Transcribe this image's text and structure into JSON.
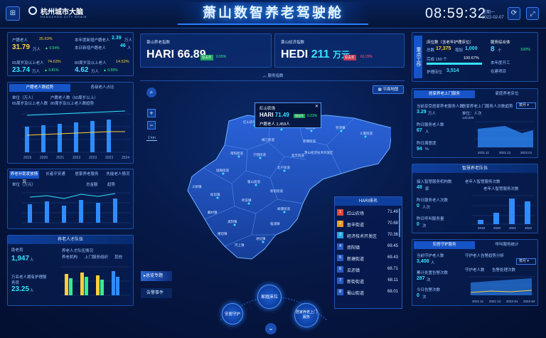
{
  "header": {
    "logo_text": "杭州城市大脑",
    "logo_sub": "HANGZHOU CITY BRAIN",
    "title": "萧山数智养老驾驶舱",
    "time": "08:59:32",
    "weekday": "星期一",
    "date": "2022-02-07"
  },
  "left1": {
    "items": [
      {
        "label": "户籍老人",
        "pct": "25.63%",
        "val": "31.79",
        "unit": "万人",
        "trend": "▲ 0.54%"
      },
      {
        "label": "本年度新增户籍老人",
        "val": "2.39",
        "unit": "万人"
      },
      {
        "label": "本日新增户籍老人",
        "val": "46",
        "unit": "人"
      },
      {
        "label": "65周岁及以上老人",
        "pct": "74.63%",
        "val": "23.74",
        "unit": "万人",
        "trend": "▲ 0.81%"
      },
      {
        "label": "80周岁及以上老人",
        "pct": "14.52%",
        "val": "4.62",
        "unit": "万人",
        "trend": "▲ 0.99%"
      }
    ]
  },
  "left2": {
    "tabs": [
      "户籍老人数趋势",
      "各级老人占比"
    ],
    "unit": "单位（万人）",
    "legend": [
      "户籍老人数（60周岁以上）",
      "65周岁及以上老人数",
      "80周岁及以上老人数趋势"
    ]
  },
  "left3": {
    "tabs": [
      "养老补助发放情况",
      "长者平安通",
      "居家养老服务",
      "失能老人情况"
    ],
    "unit": "单位（万元）",
    "legend": [
      "总金额",
      "趋势"
    ]
  },
  "left4": {
    "title": "养老人才队伍",
    "sub": "养老人才队伍情况",
    "items": [
      {
        "label": "助老员",
        "val": "1,947",
        "unit": "人"
      },
      {
        "label": "万名老人拥有护理服务员",
        "val": "23.25",
        "unit": "人"
      }
    ],
    "legend": [
      "养老机构",
      "上门服务组织",
      "其他"
    ]
  },
  "center": {
    "card1": {
      "title": "萧山养老指数",
      "code": "HARI",
      "val": "66.89",
      "badge": "较去年",
      "trend": "0.05%"
    },
    "card2": {
      "title": "萧山经济指数",
      "code": "HEDI",
      "val": "211",
      "unit": "万元",
      "badge": "较去年",
      "trend": "63.29%"
    },
    "collapse": "服务指数",
    "map_btn": "平面地图",
    "scale": "1 km",
    "tip": {
      "name": "红山农场",
      "code": "HARI",
      "val": "71.49",
      "badge": "较去年",
      "trend": "0.03%",
      "people": "户籍老人 1,459人"
    },
    "sidebtns": [
      "总览专题",
      "告警事件"
    ],
    "circles": [
      "家庭床位",
      "安居守护",
      "居家养老上门服务"
    ]
  },
  "map_labels": [
    "红山农场",
    "益农镇",
    "瓜沥镇",
    "党湾镇",
    "义蓬街道",
    "新塘街道",
    "靖江街道",
    "南阳街道",
    "宁围街道",
    "北干街道",
    "城厢街道",
    "蜀山街道",
    "新街街道",
    "衙前镇",
    "所前镇",
    "闻堰街道",
    "浦阳镇",
    "进化镇",
    "戴村镇",
    "河上镇",
    "楼塔镇",
    "临浦镇",
    "义桥镇",
    "盈丰街道",
    "萧山经济技术开发区"
  ],
  "ranking": {
    "title": "HARI排名",
    "rows": [
      {
        "rank": "1",
        "name": "红山农场",
        "val": "71.49"
      },
      {
        "rank": "2",
        "name": "盈丰街道",
        "val": "70.68"
      },
      {
        "rank": "3",
        "name": "经济技术开发区",
        "val": "70.36"
      },
      {
        "rank": "4",
        "name": "南阳镇",
        "val": "69.45"
      },
      {
        "rank": "5",
        "name": "新塘街道",
        "val": "69.43"
      },
      {
        "rank": "6",
        "name": "瓜沥镇",
        "val": "68.71"
      },
      {
        "rank": "7",
        "name": "新街街道",
        "val": "68.11"
      },
      {
        "rank": "8",
        "name": "蜀山街道",
        "val": "68.01"
      }
    ]
  },
  "right1": {
    "side": "重点工作",
    "mid_title": "床位数（含老年护理床位）",
    "items": [
      {
        "label": "总数",
        "val": "17,375"
      },
      {
        "label": "增加",
        "val": "1,000"
      },
      {
        "label": "完成 150 个",
        "val": "100.67%"
      },
      {
        "label": "护理床位",
        "val": "3,514"
      }
    ],
    "right_title": "服务综合体",
    "r_val": "8",
    "r_unit": "个",
    "r_pct": "100%",
    "r_list": [
      "本年度开工",
      "在建项目"
    ]
  },
  "right2": {
    "tabs": [
      "居家养老上门服务",
      "家庭养老床位"
    ],
    "items": [
      {
        "label": "当前享受居家养老服务人数",
        "val": "3.29",
        "unit": "万人"
      },
      {
        "label": "昨日服务老人数",
        "val": "67",
        "unit": "人"
      },
      {
        "label": "昨日满意度",
        "val": "94",
        "unit": "%"
      }
    ],
    "chart_title": "居家养老上门服务人次数趋势",
    "unit": "单位：人次",
    "sel": "按月",
    "ymax": "140,000",
    "months": [
      "2021.11",
      "2021.12",
      "2022.01"
    ]
  },
  "right3": {
    "title": "智慧养老队伍",
    "items": [
      {
        "label": "接入智慧服务机构数",
        "val": "48",
        "unit": "家"
      },
      {
        "label": "昨日服务老人次数",
        "val": "0",
        "unit": "人次"
      },
      {
        "label": "昨日呼叫服务量",
        "val": "0",
        "unit": "次"
      }
    ],
    "chart_title": "老年人智慧服务次数",
    "legend": "老年人智慧服务次数",
    "years": [
      "2019",
      "2020",
      "2021",
      "2022"
    ]
  },
  "right4": {
    "tabs": [
      "安居守护服务",
      "呼叫服务统计"
    ],
    "items": [
      {
        "label": "当前守护老人数",
        "val": "3,408",
        "unit": "人"
      },
      {
        "label": "累计处置告警次数",
        "val": "287",
        "unit": "次"
      },
      {
        "label": "今日告警次数",
        "val": "0",
        "unit": "次"
      }
    ],
    "chart_title": "守护老人告警趋势分析",
    "sel": "按月",
    "legend": [
      "守护老人数",
      "告警处理次数"
    ],
    "months": [
      "2021-11",
      "2021-12",
      "2022-01",
      "2022-02"
    ]
  }
}
